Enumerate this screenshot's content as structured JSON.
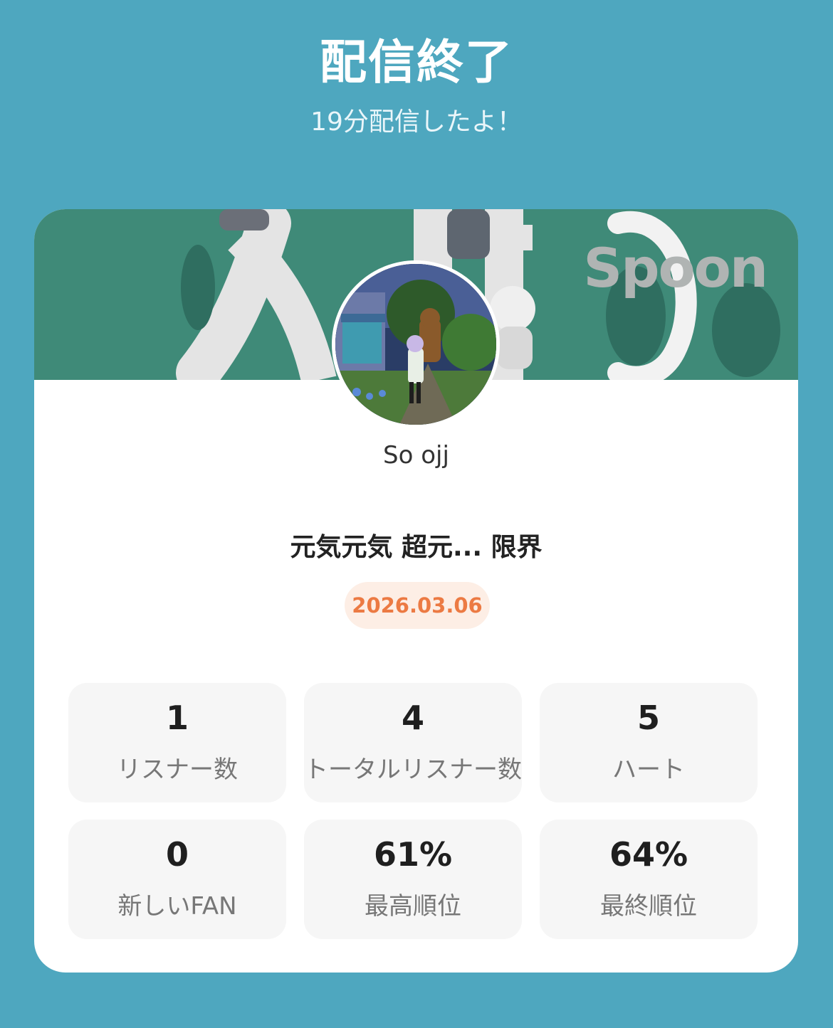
{
  "header": {
    "title": "配信終了",
    "subtitle": "19分配信したよ！"
  },
  "banner": {
    "logo_text": "Spoon",
    "background_color": "#3f8a78"
  },
  "profile": {
    "username": "So ojj"
  },
  "stream": {
    "title": "元気元気 超元... 限界",
    "date": "2026.03.06"
  },
  "stats": [
    {
      "value": "1",
      "label": "リスナー数"
    },
    {
      "value": "4",
      "label": "トータルリスナー数"
    },
    {
      "value": "5",
      "label": "ハート"
    },
    {
      "value": "0",
      "label": "新しいFAN"
    },
    {
      "value": "61%",
      "label": "最高順位"
    },
    {
      "value": "64%",
      "label": "最終順位"
    }
  ],
  "colors": {
    "page_background": "#4ea7bf",
    "date_text": "#ec7a43",
    "date_background": "#fdeee5"
  }
}
